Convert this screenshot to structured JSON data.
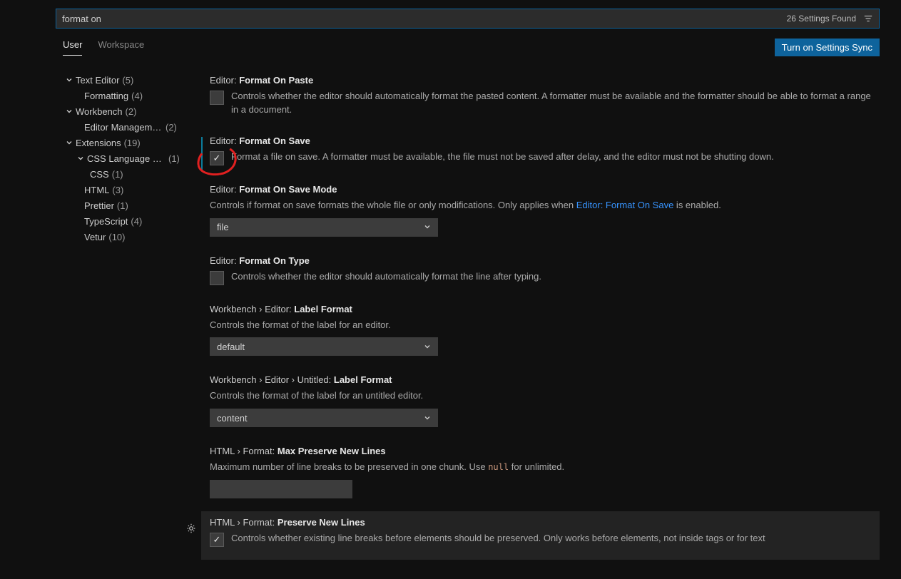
{
  "search": {
    "value": "format on",
    "results_label": "26 Settings Found"
  },
  "scope": {
    "user": "User",
    "workspace": "Workspace",
    "sync_button": "Turn on Settings Sync"
  },
  "toc": [
    {
      "label": "Text Editor",
      "count": "(5)",
      "indent": 1,
      "expandable": true
    },
    {
      "label": "Formatting",
      "count": "(4)",
      "indent": 2,
      "leaf": true
    },
    {
      "label": "Workbench",
      "count": "(2)",
      "indent": 1,
      "expandable": true
    },
    {
      "label": "Editor Manageme…",
      "count": "(2)",
      "indent": 2,
      "leaf": true
    },
    {
      "label": "Extensions",
      "count": "(19)",
      "indent": 1,
      "expandable": true
    },
    {
      "label": "CSS Language Fe…",
      "count": "(1)",
      "indent": 2,
      "expandable": true
    },
    {
      "label": "CSS",
      "count": "(1)",
      "indent": 3,
      "leaf": true
    },
    {
      "label": "HTML",
      "count": "(3)",
      "indent": 2,
      "leaf": true
    },
    {
      "label": "Prettier",
      "count": "(1)",
      "indent": 2,
      "leaf": true
    },
    {
      "label": "TypeScript",
      "count": "(4)",
      "indent": 2,
      "leaf": true
    },
    {
      "label": "Vetur",
      "count": "(10)",
      "indent": 2,
      "leaf": true
    }
  ],
  "settings": {
    "format_on_paste": {
      "prefix": "Editor: ",
      "name": "Format On Paste",
      "desc": "Controls whether the editor should automatically format the pasted content. A formatter must be available and the formatter should be able to format a range in a document."
    },
    "format_on_save": {
      "prefix": "Editor: ",
      "name": "Format On Save",
      "desc": "Format a file on save. A formatter must be available, the file must not be saved after delay, and the editor must not be shutting down."
    },
    "format_on_save_mode": {
      "prefix": "Editor: ",
      "name": "Format On Save Mode",
      "desc_before": "Controls if format on save formats the whole file or only modifications. Only applies when ",
      "desc_link": "Editor: Format On Save",
      "desc_after": " is enabled.",
      "value": "file"
    },
    "format_on_type": {
      "prefix": "Editor: ",
      "name": "Format On Type",
      "desc": "Controls whether the editor should automatically format the line after typing."
    },
    "label_format": {
      "prefix": "Workbench › Editor: ",
      "name": "Label Format",
      "desc": "Controls the format of the label for an editor.",
      "value": "default"
    },
    "untitled_label_format": {
      "prefix": "Workbench › Editor › Untitled: ",
      "name": "Label Format",
      "desc": "Controls the format of the label for an untitled editor.",
      "value": "content"
    },
    "max_preserve": {
      "prefix": "HTML › Format: ",
      "name": "Max Preserve New Lines",
      "desc_before": "Maximum number of line breaks to be preserved in one chunk. Use ",
      "code": "null",
      "desc_after": " for unlimited."
    },
    "preserve_newlines": {
      "prefix": "HTML › Format: ",
      "name": "Preserve New Lines",
      "desc": "Controls whether existing line breaks before elements should be preserved. Only works before elements, not inside tags or for text"
    }
  }
}
